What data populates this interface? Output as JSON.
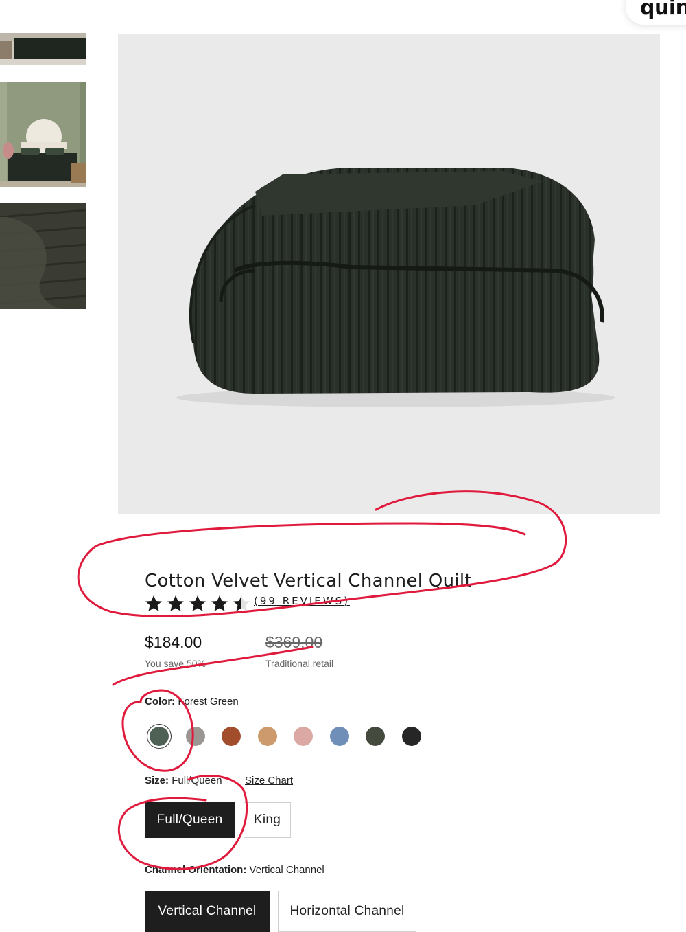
{
  "brand": {
    "logo_text": "quinc"
  },
  "gallery": {
    "thumbnails": [
      {
        "icon": "bedroom-thumbnail"
      },
      {
        "icon": "bedroom-green-wall-thumbnail"
      },
      {
        "icon": "quilt-closeup-thumbnail"
      }
    ],
    "main_image": {
      "icon": "folded-velvet-quilt-image"
    }
  },
  "product": {
    "title": "Cotton Velvet Vertical Channel Quilt",
    "rating": 4.5,
    "rating_max": 5,
    "reviews_label": "(99 REVIEWS)",
    "price": "$184.00",
    "save_text": "You save 50%",
    "retail_price": "$369.00",
    "retail_label": "Traditional retail"
  },
  "color": {
    "label": "Color:",
    "selected": "Forest Green",
    "swatches": [
      "#4f6155",
      "#9b9692",
      "#a24e2c",
      "#cc9a6c",
      "#dba8a4",
      "#6f8eb8",
      "#454a3e",
      "#262626"
    ]
  },
  "size": {
    "label": "Size:",
    "selected": "Full/Queen",
    "chart_link": "Size Chart",
    "options": [
      "Full/Queen",
      "King"
    ]
  },
  "orientation": {
    "label": "Channel Orientation:",
    "selected": "Vertical Channel",
    "options": [
      "Vertical Channel",
      "Horizontal Channel"
    ]
  },
  "annotation_color": "#e01a3c"
}
